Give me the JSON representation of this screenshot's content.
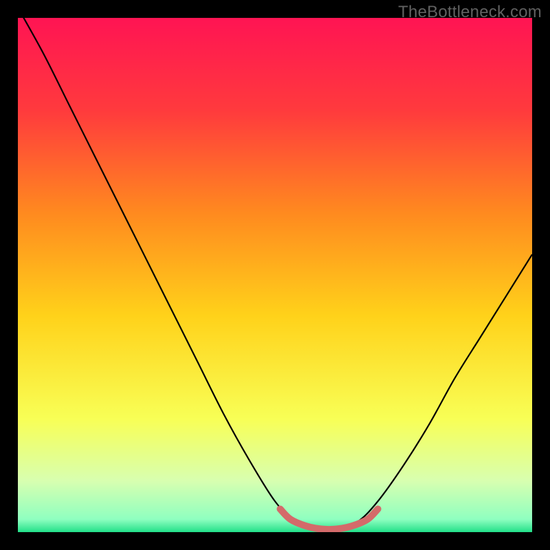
{
  "watermark": "TheBottleneck.com",
  "chart_data": {
    "type": "line",
    "title": "",
    "xlabel": "",
    "ylabel": "",
    "xlim": [
      0,
      1
    ],
    "ylim": [
      0,
      1
    ],
    "series": [
      {
        "name": "bottleneck-curve",
        "x": [
          0.0,
          0.05,
          0.1,
          0.15,
          0.2,
          0.25,
          0.3,
          0.35,
          0.4,
          0.45,
          0.5,
          0.54,
          0.58,
          0.62,
          0.66,
          0.7,
          0.75,
          0.8,
          0.85,
          0.9,
          0.95,
          1.0
        ],
        "values": [
          1.02,
          0.93,
          0.83,
          0.73,
          0.63,
          0.53,
          0.43,
          0.33,
          0.23,
          0.14,
          0.06,
          0.02,
          0.01,
          0.01,
          0.02,
          0.06,
          0.13,
          0.21,
          0.3,
          0.38,
          0.46,
          0.54
        ]
      },
      {
        "name": "optimal-region",
        "x": [
          0.51,
          0.53,
          0.56,
          0.59,
          0.62,
          0.65,
          0.68,
          0.7
        ],
        "values": [
          0.045,
          0.025,
          0.012,
          0.006,
          0.006,
          0.012,
          0.025,
          0.045
        ]
      }
    ],
    "background_gradient": {
      "stops": [
        {
          "offset": 0.0,
          "color": "#ff1453"
        },
        {
          "offset": 0.18,
          "color": "#ff3a3d"
        },
        {
          "offset": 0.38,
          "color": "#ff8a1f"
        },
        {
          "offset": 0.58,
          "color": "#ffd21a"
        },
        {
          "offset": 0.78,
          "color": "#f8ff56"
        },
        {
          "offset": 0.9,
          "color": "#d8ffb0"
        },
        {
          "offset": 0.975,
          "color": "#8fffc0"
        },
        {
          "offset": 1.0,
          "color": "#22e089"
        }
      ]
    },
    "colors": {
      "curve": "#000000",
      "optimal": "#d46a6a"
    }
  }
}
